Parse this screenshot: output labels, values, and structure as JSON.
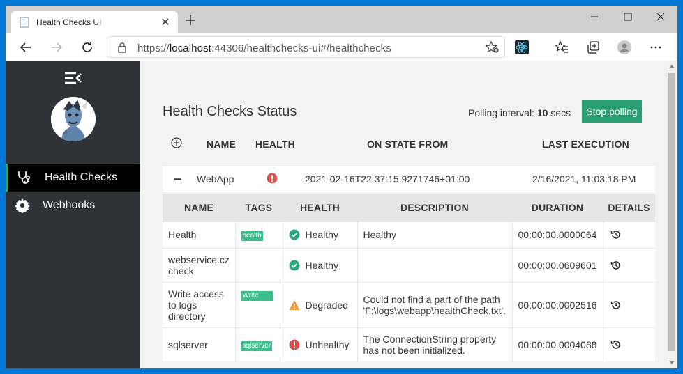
{
  "browser": {
    "tab_title": "Health Checks UI",
    "url_scheme": "https://",
    "url_host": "localhost",
    "url_rest": ":44306/healthchecks-ui#/healthchecks"
  },
  "sidebar": {
    "items": [
      {
        "label": "Health Checks",
        "icon": "stethoscope-icon",
        "active": true
      },
      {
        "label": "Webhooks",
        "icon": "gear-icon",
        "active": false
      }
    ]
  },
  "main": {
    "title": "Health Checks Status",
    "polling_label": "Polling interval:",
    "polling_value": "10",
    "polling_unit": "secs",
    "stop_button": "Stop polling",
    "columns": {
      "name": "NAME",
      "health": "HEALTH",
      "on_state_from": "ON STATE FROM",
      "last_execution": "LAST EXECUTION"
    },
    "webapp": {
      "name": "WebApp",
      "health": "Unhealthy",
      "on_state_from": "2021-02-16T22:37:15.9271746+01:00",
      "last_execution": "2/16/2021, 11:03:18 PM"
    },
    "details_columns": {
      "name": "NAME",
      "tags": "TAGS",
      "health": "HEALTH",
      "description": "DESCRIPTION",
      "duration": "DURATION",
      "details": "DETAILS"
    },
    "entries": [
      {
        "name": "Health",
        "tag": "health",
        "health": "Healthy",
        "description": "Healthy",
        "duration": "00:00:00.0000064"
      },
      {
        "name": "webservice.cz check",
        "tag": "",
        "health": "Healthy",
        "description": "",
        "duration": "00:00:00.0609601"
      },
      {
        "name": "Write access to logs directory",
        "tag": "Write",
        "health": "Degraded",
        "description": "Could not find a part of the path 'F:\\logs\\webapp\\healthCheck.txt'.",
        "duration": "00:00:00.0002516"
      },
      {
        "name": "sqlserver",
        "tag": "sqlserver",
        "health": "Unhealthy",
        "description": "The ConnectionString property has not been initialized.",
        "duration": "00:00:00.0004088"
      }
    ]
  },
  "colors": {
    "accent": "#2a9f75",
    "healthy": "#2aa879",
    "degraded": "#f39c33",
    "unhealthy": "#d9534f",
    "sidebar_bg": "#2f3237"
  }
}
